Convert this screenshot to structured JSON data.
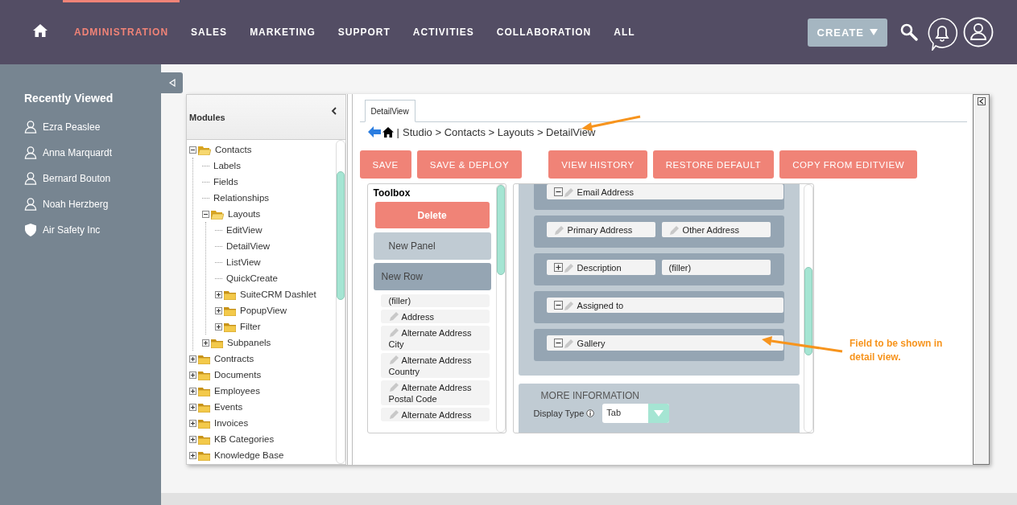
{
  "top_nav": {
    "items": [
      {
        "label": "ADMINISTRATION",
        "selected": true
      },
      {
        "label": "SALES",
        "selected": false
      },
      {
        "label": "MARKETING",
        "selected": false
      },
      {
        "label": "SUPPORT",
        "selected": false
      },
      {
        "label": "ACTIVITIES",
        "selected": false
      },
      {
        "label": "COLLABORATION",
        "selected": false
      },
      {
        "label": "ALL",
        "selected": false
      }
    ],
    "create_button": "CREATE"
  },
  "sidebar": {
    "title": "Recently Viewed",
    "items": [
      {
        "label": "Ezra Peaslee",
        "kind": "contact"
      },
      {
        "label": "Anna Marquardt",
        "kind": "contact"
      },
      {
        "label": "Bernard Bouton",
        "kind": "contact"
      },
      {
        "label": "Noah Herzberg",
        "kind": "contact"
      },
      {
        "label": "Air Safety Inc",
        "kind": "account"
      }
    ]
  },
  "studio": {
    "tree_title": "Modules",
    "tree": [
      {
        "label": "Contacts",
        "kind": "folder",
        "expanded": true,
        "children": [
          {
            "label": "Labels",
            "kind": "page"
          },
          {
            "label": "Fields",
            "kind": "page"
          },
          {
            "label": "Relationships",
            "kind": "page"
          },
          {
            "label": "Layouts",
            "kind": "folder",
            "expanded": true,
            "children": [
              {
                "label": "EditView",
                "kind": "page"
              },
              {
                "label": "DetailView",
                "kind": "page"
              },
              {
                "label": "ListView",
                "kind": "page"
              },
              {
                "label": "QuickCreate",
                "kind": "page"
              },
              {
                "label": "SuiteCRM Dashlet",
                "kind": "folder",
                "expanded": false
              },
              {
                "label": "PopupView",
                "kind": "folder",
                "expanded": false
              },
              {
                "label": "Filter",
                "kind": "folder",
                "expanded": false
              }
            ]
          },
          {
            "label": "Subpanels",
            "kind": "folder",
            "expanded": false
          }
        ]
      },
      {
        "label": "Contracts",
        "kind": "folder",
        "expanded": false
      },
      {
        "label": "Documents",
        "kind": "folder",
        "expanded": false
      },
      {
        "label": "Employees",
        "kind": "folder",
        "expanded": false
      },
      {
        "label": "Events",
        "kind": "folder",
        "expanded": false
      },
      {
        "label": "Invoices",
        "kind": "folder",
        "expanded": false
      },
      {
        "label": "KB Categories",
        "kind": "folder",
        "expanded": false
      },
      {
        "label": "Knowledge Base",
        "kind": "folder",
        "expanded": false
      }
    ],
    "tab": {
      "label": "DetailView",
      "selected": true
    },
    "breadcrumb": {
      "separator": "|",
      "path": "Studio > Contacts > Layouts > DetailView"
    },
    "button_groups": [
      [
        "SAVE",
        "SAVE & DEPLOY"
      ],
      [
        "VIEW HISTORY",
        "RESTORE DEFAULT",
        "COPY FROM EDITVIEW"
      ]
    ],
    "toolbox": {
      "title": "Toolbox",
      "delete": "Delete",
      "new_panel": "New Panel",
      "new_row": "New Row",
      "fields": [
        {
          "label": "(filler)",
          "kind": "filler"
        },
        {
          "label": "Address",
          "kind": "field"
        },
        {
          "label": "Alternate Address City",
          "kind": "field"
        },
        {
          "label": "Alternate Address Country",
          "kind": "field"
        },
        {
          "label": "Alternate Address Postal Code",
          "kind": "field"
        },
        {
          "label": "Alternate Address",
          "kind": "field"
        }
      ]
    },
    "layout": {
      "rows": [
        {
          "fields": [
            {
              "label": "Email Address",
              "kind": "field",
              "expanded": true
            }
          ]
        },
        {
          "fields": [
            {
              "label": "Primary Address",
              "kind": "field"
            },
            {
              "label": "Other Address",
              "kind": "field"
            }
          ]
        },
        {
          "fields": [
            {
              "label": "Description",
              "kind": "field",
              "expanded": false
            },
            {
              "label": "(filler)",
              "kind": "filler"
            }
          ]
        },
        {
          "fields": [
            {
              "label": "Assigned to",
              "kind": "field",
              "expanded": true
            }
          ]
        },
        {
          "fields": [
            {
              "label": "Gallery",
              "kind": "field",
              "expanded": true
            }
          ]
        }
      ],
      "next_panel": {
        "title": "MORE INFORMATION",
        "display_type_label": "Display Type",
        "display_type_value": "Tab"
      }
    }
  },
  "annotation": {
    "text": "Field to be shown in detail view."
  }
}
